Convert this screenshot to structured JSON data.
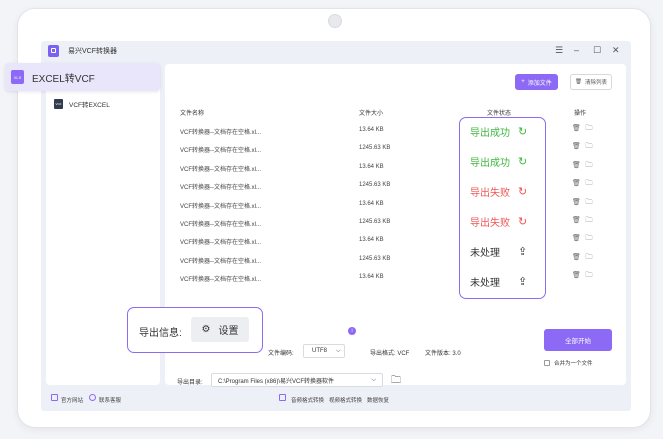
{
  "app": {
    "title": "易兴VCF转换器"
  },
  "window_controls": {
    "menu": "☰",
    "minimize": "–",
    "maximize": "☐",
    "close": "✕"
  },
  "sidebar": {
    "active_badge": {
      "icon_text": "XLS",
      "label": "EXCEL转VCF"
    },
    "items": [
      {
        "icon_text": "VCF",
        "label": "VCF转EXCEL"
      }
    ]
  },
  "toolbar": {
    "add_label": "添加文件",
    "add_icon": "+",
    "clear_label": "清除列表",
    "clear_icon": "🗑"
  },
  "table": {
    "headers": [
      "文件名称",
      "文件大小",
      "文件状态",
      "操作"
    ],
    "rows": [
      {
        "name": "VCF转换器--文档存在空格.xl...",
        "size": "13.64  KB"
      },
      {
        "name": "VCF转换器--文档存在空格.xl...",
        "size": "1245.63  KB"
      },
      {
        "name": "VCF转换器--文档存在空格.xl...",
        "size": "13.64  KB"
      },
      {
        "name": "VCF转换器--文档存在空格.xl...",
        "size": "1245.63  KB"
      },
      {
        "name": "VCF转换器--文档存在空格.xl...",
        "size": "13.64  KB"
      },
      {
        "name": "VCF转换器--文档存在空格.xl...",
        "size": "1245.63  KB"
      },
      {
        "name": "VCF转换器--文档存在空格.xl...",
        "size": "13.64  KB"
      },
      {
        "name": "VCF转换器--文档存在空格.xl...",
        "size": "1245.63  KB"
      },
      {
        "name": "VCF转换器--文档存在空格.xl...",
        "size": "13.64  KB"
      }
    ],
    "op_icons": {
      "delete": "🗑",
      "folder": "🗀"
    }
  },
  "status_popup": {
    "items": [
      {
        "label": "导出成功",
        "icon": "↻",
        "kind": "success",
        "color": "#3fb83f"
      },
      {
        "label": "导出成功",
        "icon": "↻",
        "kind": "success",
        "color": "#3fb83f"
      },
      {
        "label": "导出失败",
        "icon": "↻",
        "kind": "fail",
        "color": "#f05555"
      },
      {
        "label": "导出失败",
        "icon": "↻",
        "kind": "fail",
        "color": "#f05555"
      },
      {
        "label": "未处理",
        "icon": "⇪",
        "kind": "none",
        "color": "#333333"
      },
      {
        "label": "未处理",
        "icon": "⇪",
        "kind": "none",
        "color": "#333333"
      }
    ]
  },
  "export_info": {
    "label": "导出信息:",
    "settings_label": "设置",
    "settings_icon": "⚙"
  },
  "options": {
    "encoding_label": "文件编码:",
    "encoding_value": "UTF8",
    "info_icon": "i",
    "format_label": "导出格式: VCF",
    "version_label": "文件版本: 3.0",
    "dir_label": "导出目录:",
    "dir_value": "C:\\Program Files (x86)\\易兴VCF转换器软件",
    "dropdown_icon": "⌵",
    "folder_icon": "🗀"
  },
  "actions": {
    "start_label": "全部开始",
    "merge_label": "合并为一个文件",
    "merge_checked": false
  },
  "footer": {
    "website": "官方网站",
    "support": "联系客服",
    "links": [
      "音频格式转换",
      "视频格式转换",
      "数据恢复"
    ]
  },
  "colors": {
    "accent": "#8c6af5",
    "success": "#3fb83f",
    "fail": "#f05555"
  }
}
